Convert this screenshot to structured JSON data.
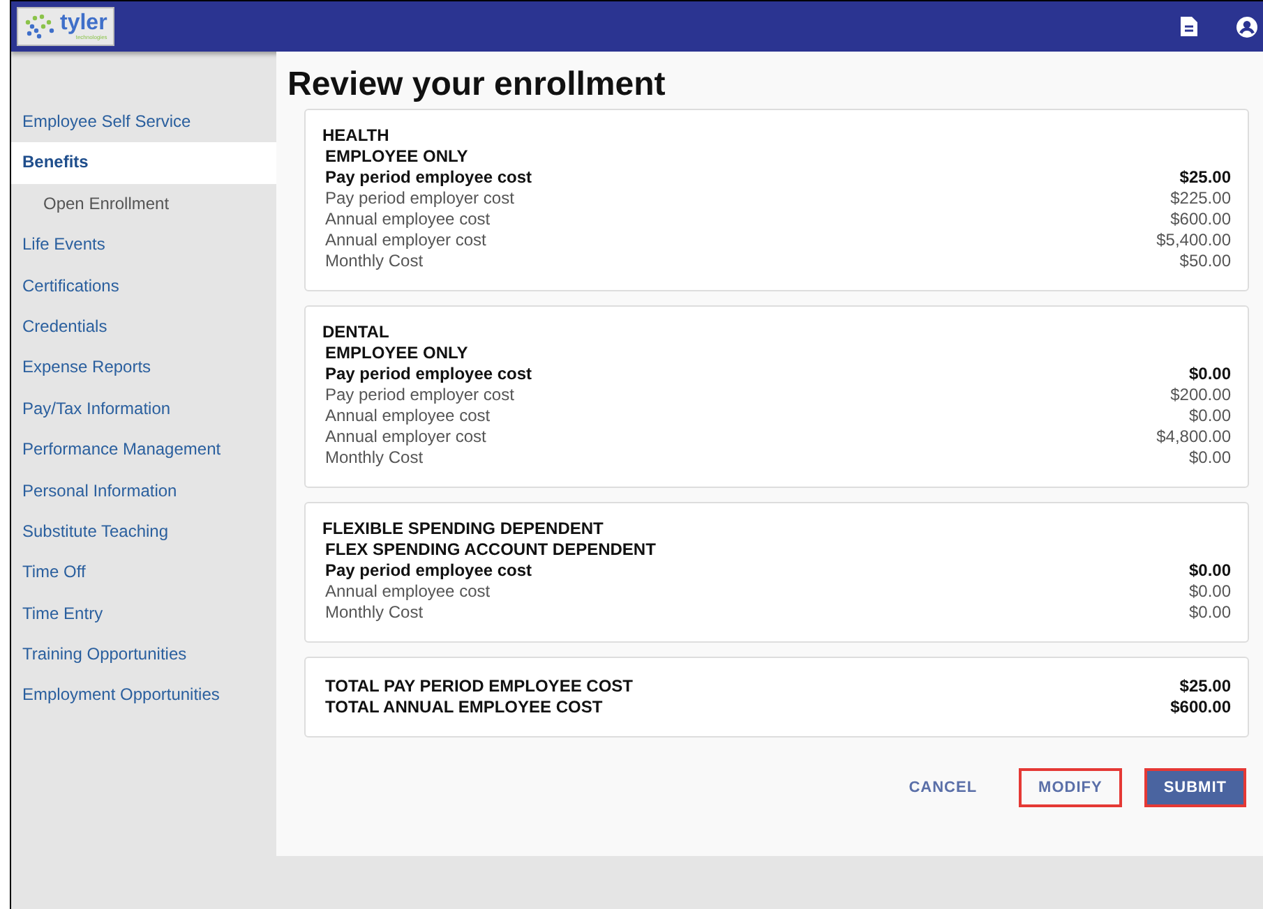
{
  "header": {
    "logo": {
      "name": "tyler",
      "tagline": "technologies"
    }
  },
  "sidebar": {
    "items": [
      {
        "label": "Employee Self Service",
        "selected": false
      },
      {
        "label": "Benefits",
        "selected": true,
        "children": [
          {
            "label": "Open Enrollment",
            "selected": false
          }
        ]
      },
      {
        "label": "Life Events",
        "selected": false
      },
      {
        "label": "Certifications",
        "selected": false
      },
      {
        "label": "Credentials",
        "selected": false
      },
      {
        "label": "Expense Reports",
        "selected": false
      },
      {
        "label": "Pay/Tax Information",
        "selected": false
      },
      {
        "label": "Performance Management",
        "selected": false
      },
      {
        "label": "Personal Information",
        "selected": false
      },
      {
        "label": "Substitute Teaching",
        "selected": false
      },
      {
        "label": "Time Off",
        "selected": false
      },
      {
        "label": "Time Entry",
        "selected": false
      },
      {
        "label": "Training Opportunities",
        "selected": false
      },
      {
        "label": "Employment Opportunities",
        "selected": false
      }
    ]
  },
  "page_title": "Review your enrollment",
  "cards": [
    {
      "heading": "HEALTH",
      "subheading": "EMPLOYEE ONLY",
      "rows": [
        {
          "label": "Pay period employee cost",
          "value": "$25.00",
          "bold": true
        },
        {
          "label": "Pay period employer cost",
          "value": "$225.00",
          "bold": false
        },
        {
          "label": "Annual employee cost",
          "value": "$600.00",
          "bold": false
        },
        {
          "label": "Annual employer cost",
          "value": "$5,400.00",
          "bold": false
        },
        {
          "label": "Monthly Cost",
          "value": "$50.00",
          "bold": false
        }
      ]
    },
    {
      "heading": "DENTAL",
      "subheading": "EMPLOYEE ONLY",
      "rows": [
        {
          "label": "Pay period employee cost",
          "value": "$0.00",
          "bold": true
        },
        {
          "label": "Pay period employer cost",
          "value": "$200.00",
          "bold": false
        },
        {
          "label": "Annual employee cost",
          "value": "$0.00",
          "bold": false
        },
        {
          "label": "Annual employer cost",
          "value": "$4,800.00",
          "bold": false
        },
        {
          "label": "Monthly Cost",
          "value": "$0.00",
          "bold": false
        }
      ]
    },
    {
      "heading": "FLEXIBLE SPENDING DEPENDENT",
      "subheading": "FLEX SPENDING ACCOUNT DEPENDENT",
      "rows": [
        {
          "label": "Pay period employee cost",
          "value": "$0.00",
          "bold": true
        },
        {
          "label": "Annual employee cost",
          "value": "$0.00",
          "bold": false
        },
        {
          "label": "Monthly Cost",
          "value": "$0.00",
          "bold": false
        }
      ]
    }
  ],
  "totals": [
    {
      "label": "TOTAL PAY PERIOD EMPLOYEE COST",
      "value": "$25.00"
    },
    {
      "label": "TOTAL ANNUAL EMPLOYEE COST",
      "value": "$600.00"
    }
  ],
  "buttons": [
    {
      "label": "CANCEL",
      "kind": "text",
      "highlighted": false
    },
    {
      "label": "MODIFY",
      "kind": "text",
      "highlighted": true
    },
    {
      "label": "SUBMIT",
      "kind": "primary",
      "highlighted": true
    }
  ]
}
